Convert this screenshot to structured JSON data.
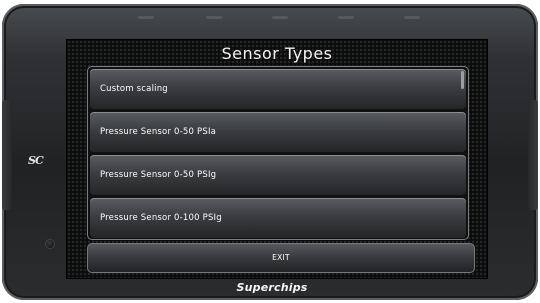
{
  "device": {
    "logo_text": "SC",
    "brand_text": "Superchips"
  },
  "screen": {
    "title": "Sensor Types",
    "items": [
      {
        "label": "Custom scaling"
      },
      {
        "label": "Pressure Sensor 0-50 PSIa"
      },
      {
        "label": "Pressure Sensor 0-50 PSIg"
      },
      {
        "label": "Pressure Sensor 0-100 PSIg"
      }
    ],
    "exit_label": "EXIT"
  },
  "colors": {
    "bezel": "#202224",
    "screen_bg": "#0c0c0d",
    "button_top": "#5a5d61",
    "button_bottom": "#232527",
    "text": "#ffffff"
  },
  "icons": {
    "logo": "sc-logo-icon",
    "power": "power-indicator-icon"
  }
}
